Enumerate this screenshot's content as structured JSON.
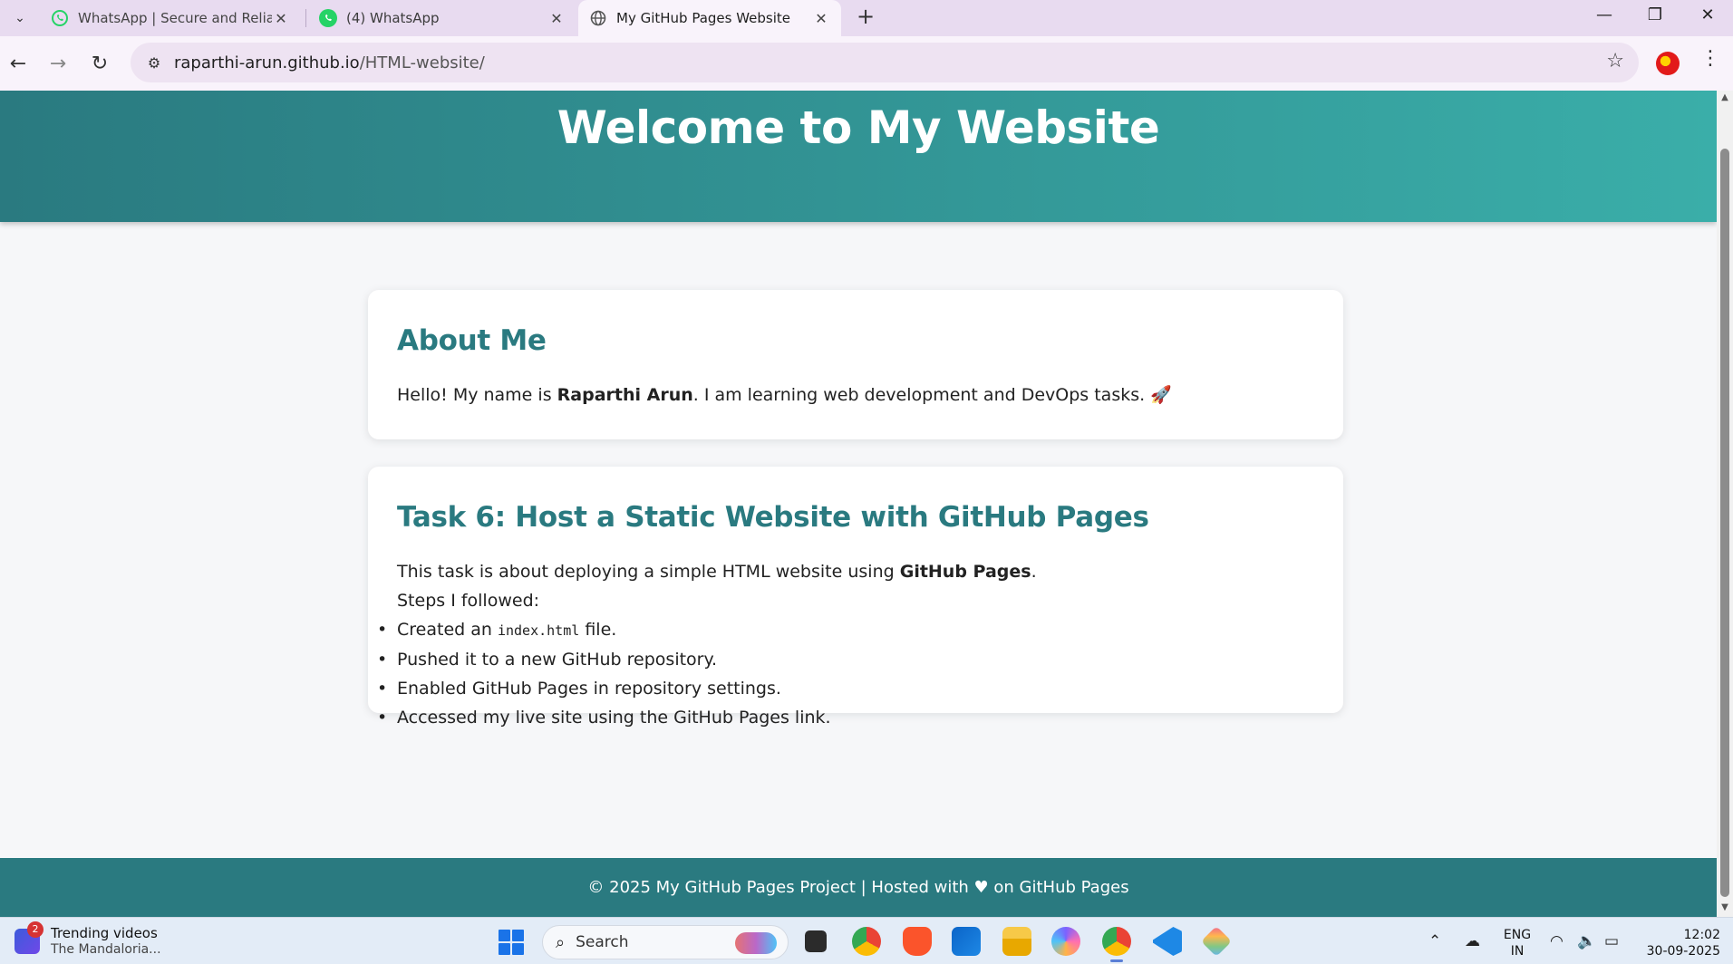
{
  "browser": {
    "tabs": [
      {
        "title": "WhatsApp | Secure and Reliable",
        "favicon": "whatsapp-icon",
        "active": false
      },
      {
        "title": "(4) WhatsApp",
        "favicon": "whatsapp-business-icon",
        "active": false
      },
      {
        "title": "My GitHub Pages Website",
        "favicon": "globe-icon",
        "active": true
      }
    ],
    "url_domain": "raparthi-arun.github.io",
    "url_path": "/HTML-website/"
  },
  "page": {
    "header_title": "Welcome to My Website",
    "about": {
      "heading": "About Me",
      "intro": "Hello! My name is ",
      "name": "Raparthi Arun",
      "outro": ". I am learning web development and DevOps tasks. 🚀"
    },
    "task": {
      "heading": "Task 6: Host a Static Website with GitHub Pages",
      "desc_pre": "This task is about deploying a simple HTML website using ",
      "desc_bold": "GitHub Pages",
      "desc_post": ".",
      "steps_label": "Steps I followed:",
      "step1_pre": "Created an ",
      "step1_code": "index.html",
      "step1_post": " file.",
      "step2": "Pushed it to a new GitHub repository.",
      "step3": "Enabled GitHub Pages in repository settings.",
      "step4": "Accessed my live site using the GitHub Pages link."
    },
    "footer": "© 2025 My GitHub Pages Project | Hosted with ♥ on GitHub Pages"
  },
  "taskbar": {
    "widget_badge": "2",
    "widget_title": "Trending videos",
    "widget_sub": "The Mandaloria...",
    "search_label": "Search",
    "lang_top": "ENG",
    "lang_bottom": "IN",
    "time": "12:02",
    "date": "30-09-2025"
  },
  "colors": {
    "header_start": "#2a7a80",
    "header_end": "#3aaea9",
    "accent": "#2a7a80"
  }
}
